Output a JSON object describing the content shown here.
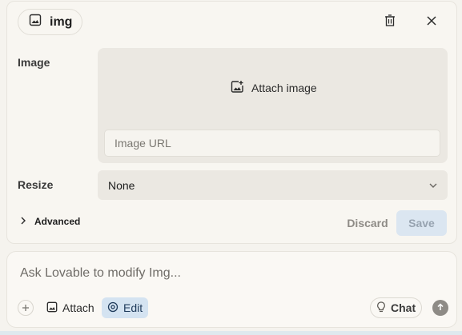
{
  "header": {
    "chip_label": "img"
  },
  "form": {
    "image_label": "Image",
    "attach_image_label": "Attach image",
    "url_placeholder": "Image URL",
    "resize_label": "Resize",
    "resize_value": "None",
    "advanced_label": "Advanced",
    "discard_label": "Discard",
    "save_label": "Save"
  },
  "composer": {
    "placeholder": "Ask Lovable to modify Img...",
    "attach_label": "Attach",
    "edit_label": "Edit",
    "chat_label": "Chat"
  },
  "colors": {
    "background": "#f5f3ee",
    "save_bg": "#dbe6f1",
    "edit_bg": "#d4e3f1"
  },
  "icons": [
    "image-icon",
    "trash-icon",
    "close-icon",
    "image-plus-icon",
    "chevron-down-icon",
    "chevron-right-icon",
    "plus-icon",
    "target-icon",
    "lightbulb-icon",
    "arrow-up-icon"
  ]
}
